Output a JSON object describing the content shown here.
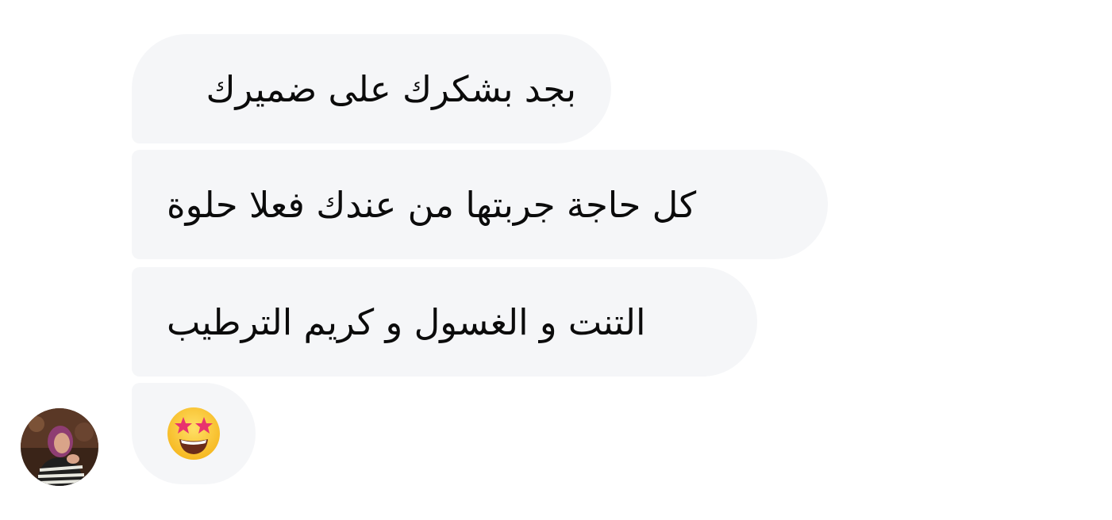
{
  "messages": [
    {
      "text": "بجد بشكرك على ضميرك"
    },
    {
      "text": "كل حاجة جربتها من عندك فعلا حلوة"
    },
    {
      "text": "التنت و الغسول و كريم الترطيب"
    },
    {
      "emoji": "star-struck-emoji"
    }
  ],
  "sender": {
    "avatar": "user-avatar"
  },
  "colors": {
    "bubble_bg": "#f5f6f8",
    "page_bg": "#ffffff",
    "text": "#0b0b0b"
  }
}
